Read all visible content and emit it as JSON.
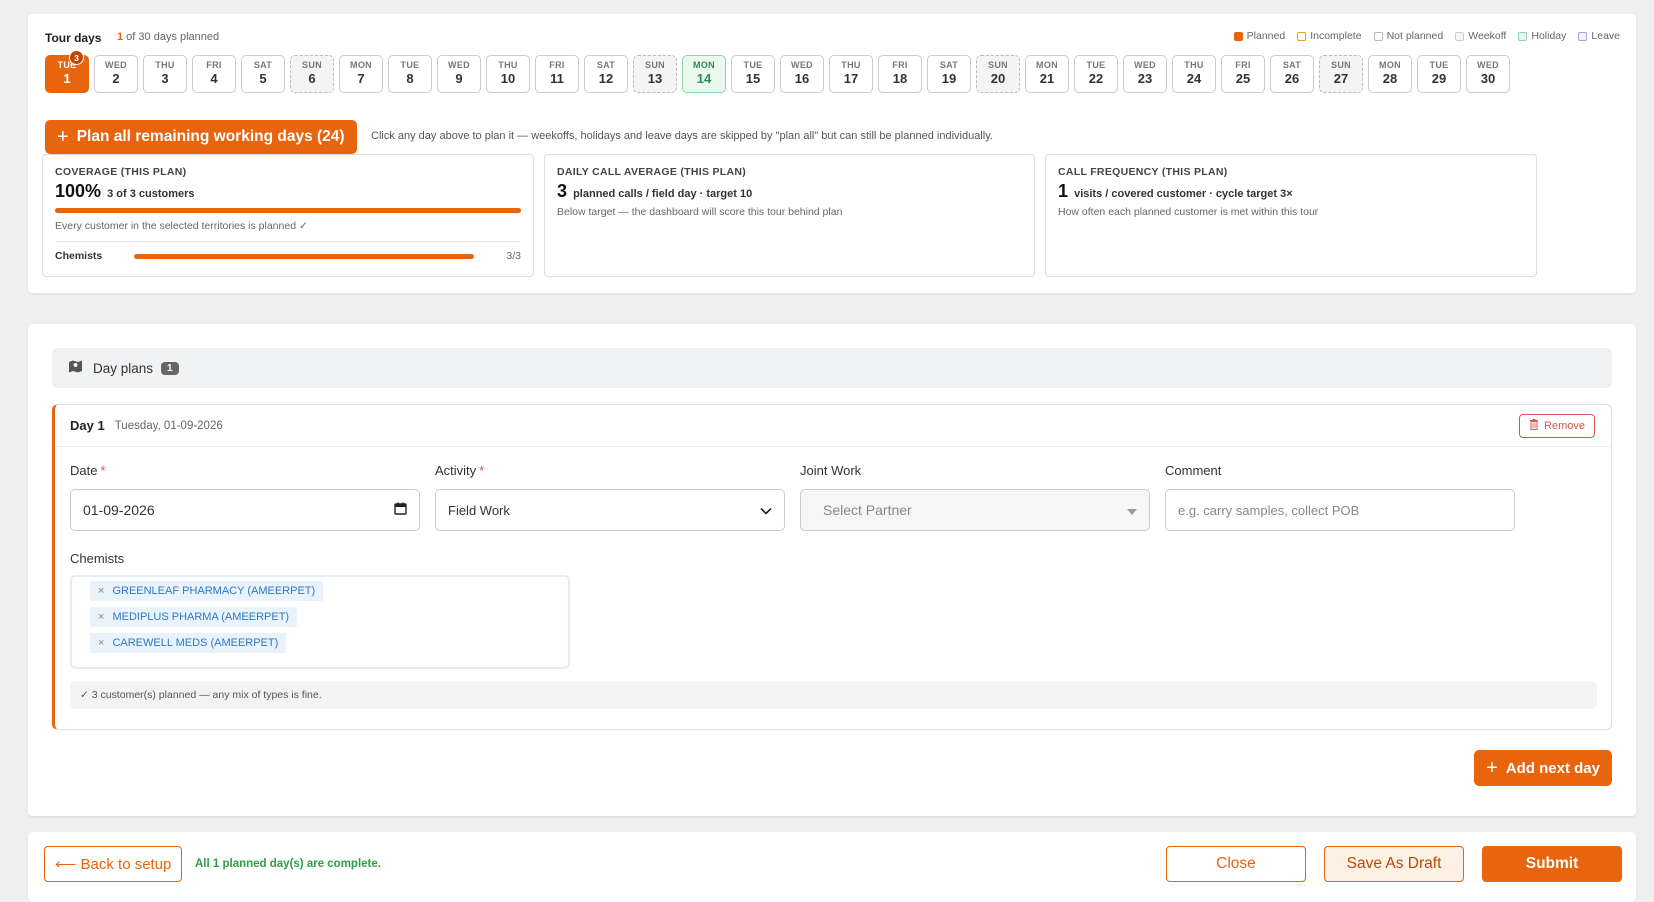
{
  "header": {
    "title": "Tour days",
    "planned_count": "1",
    "planned_suffix": " of 30 days planned"
  },
  "legend": [
    {
      "label": "Planned",
      "color": "#e8650e",
      "fill": "#e8650e"
    },
    {
      "label": "Incomplete",
      "color": "#e8a20e",
      "fill": "#ffffff"
    },
    {
      "label": "Not planned",
      "color": "#bbbbbb",
      "fill": "#ffffff"
    },
    {
      "label": "Weekoff",
      "color": "#cccccc",
      "fill": "#f4f4f4"
    },
    {
      "label": "Holiday",
      "color": "#8ed6a6",
      "fill": "#ebf8ef"
    },
    {
      "label": "Leave",
      "color": "#b59ad6",
      "fill": "#f5f0fb"
    }
  ],
  "days": [
    {
      "dow": "TUE",
      "num": "1",
      "status": "planned",
      "badge": "3"
    },
    {
      "dow": "WED",
      "num": "2",
      "status": "not-planned"
    },
    {
      "dow": "THU",
      "num": "3",
      "status": "not-planned"
    },
    {
      "dow": "FRI",
      "num": "4",
      "status": "not-planned"
    },
    {
      "dow": "SAT",
      "num": "5",
      "status": "not-planned"
    },
    {
      "dow": "SUN",
      "num": "6",
      "status": "weekoff"
    },
    {
      "dow": "MON",
      "num": "7",
      "status": "not-planned"
    },
    {
      "dow": "TUE",
      "num": "8",
      "status": "not-planned"
    },
    {
      "dow": "WED",
      "num": "9",
      "status": "not-planned"
    },
    {
      "dow": "THU",
      "num": "10",
      "status": "not-planned"
    },
    {
      "dow": "FRI",
      "num": "11",
      "status": "not-planned"
    },
    {
      "dow": "SAT",
      "num": "12",
      "status": "not-planned"
    },
    {
      "dow": "SUN",
      "num": "13",
      "status": "weekoff"
    },
    {
      "dow": "MON",
      "num": "14",
      "status": "holiday"
    },
    {
      "dow": "TUE",
      "num": "15",
      "status": "not-planned"
    },
    {
      "dow": "WED",
      "num": "16",
      "status": "not-planned"
    },
    {
      "dow": "THU",
      "num": "17",
      "status": "not-planned"
    },
    {
      "dow": "FRI",
      "num": "18",
      "status": "not-planned"
    },
    {
      "dow": "SAT",
      "num": "19",
      "status": "not-planned"
    },
    {
      "dow": "SUN",
      "num": "20",
      "status": "weekoff"
    },
    {
      "dow": "MON",
      "num": "21",
      "status": "not-planned"
    },
    {
      "dow": "TUE",
      "num": "22",
      "status": "not-planned"
    },
    {
      "dow": "WED",
      "num": "23",
      "status": "not-planned"
    },
    {
      "dow": "THU",
      "num": "24",
      "status": "not-planned"
    },
    {
      "dow": "FRI",
      "num": "25",
      "status": "not-planned"
    },
    {
      "dow": "SAT",
      "num": "26",
      "status": "not-planned"
    },
    {
      "dow": "SUN",
      "num": "27",
      "status": "weekoff"
    },
    {
      "dow": "MON",
      "num": "28",
      "status": "not-planned"
    },
    {
      "dow": "TUE",
      "num": "29",
      "status": "not-planned"
    },
    {
      "dow": "WED",
      "num": "30",
      "status": "not-planned"
    }
  ],
  "plan_all": {
    "label": "Plan all remaining working days (24)",
    "hint": "Click any day above to plan it — weekoffs, holidays and leave days are skipped by \"plan all\" but can still be planned individually."
  },
  "stats": {
    "coverage": {
      "title": "COVERAGE (THIS PLAN)",
      "big": "100%",
      "detail": "3 of 3 customers",
      "progress": 1.0,
      "sub": "Every customer in the selected territories is planned ✓",
      "rows": [
        {
          "label": "Chemists",
          "value": "3/3",
          "progress": 1.0
        }
      ]
    },
    "daily": {
      "title": "DAILY CALL AVERAGE (THIS PLAN)",
      "big": "3",
      "detail": "planned calls / field day · target 10",
      "sub": "Below target — the dashboard will score this tour behind plan"
    },
    "frequency": {
      "title": "CALL FREQUENCY (THIS PLAN)",
      "big": "1",
      "detail": "visits / covered customer · cycle target 3×",
      "sub": "How often each planned customer is met within this tour"
    }
  },
  "day_plans": {
    "title": "Day plans",
    "count": "1"
  },
  "day_card": {
    "title": "Day 1",
    "date_text": "Tuesday, 01-09-2026",
    "remove_label": "Remove",
    "date_label": "Date",
    "date_value": "01-09-2026",
    "activity_label": "Activity",
    "activity_value": "Field Work",
    "joint_label": "Joint Work",
    "joint_placeholder": "Select Partner",
    "comment_label": "Comment",
    "comment_placeholder": "e.g. carry samples, collect POB",
    "chemists_label": "Chemists",
    "chemists": [
      "GREENLEAF PHARMACY (AMEERPET)",
      "MEDIPLUS PHARMA (AMEERPET)",
      "CAREWELL MEDS (AMEERPET)"
    ],
    "note": "✓ 3 customer(s) planned — any mix of types is fine.",
    "required_mark": "*"
  },
  "add_next": {
    "label": "Add next day"
  },
  "footer": {
    "back_label": "Back to setup",
    "complete_msg": "All 1 planned day(s) are complete.",
    "close_label": "Close",
    "draft_label": "Save As Draft",
    "submit_label": "Submit"
  }
}
